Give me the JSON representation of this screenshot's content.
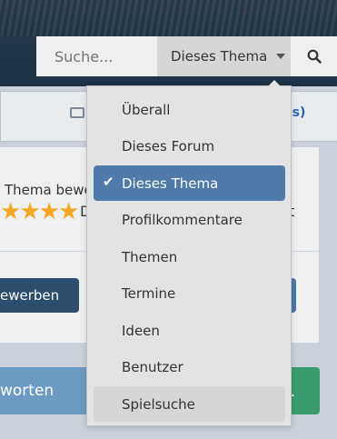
{
  "search": {
    "placeholder": "Suche...",
    "scope_label": "Dieses Thema"
  },
  "page": {
    "rate_text": "Thema bewer",
    "button_left_label": "ewerben",
    "footer_left_label": "worten",
    "footer_right_label": ".",
    "fragment_d": "D",
    "fragment_t": "t",
    "link_fragment": "os)"
  },
  "rating": {
    "value": 3.5,
    "max": 4
  },
  "dropdown": {
    "items": [
      {
        "label": "Überall",
        "selected": false
      },
      {
        "label": "Dieses Forum",
        "selected": false
      },
      {
        "label": "Dieses Thema",
        "selected": true
      },
      {
        "label": "Profilkommentare",
        "selected": false
      },
      {
        "label": "Themen",
        "selected": false
      },
      {
        "label": "Termine",
        "selected": false
      },
      {
        "label": "Ideen",
        "selected": false
      },
      {
        "label": "Benutzer",
        "selected": false
      },
      {
        "label": "Spielsuche",
        "selected": false,
        "hover": true
      }
    ]
  },
  "colors": {
    "accent": "#4f7bab",
    "banner": "#22364a",
    "star": "#f5a623",
    "green": "#3a9c6e"
  }
}
